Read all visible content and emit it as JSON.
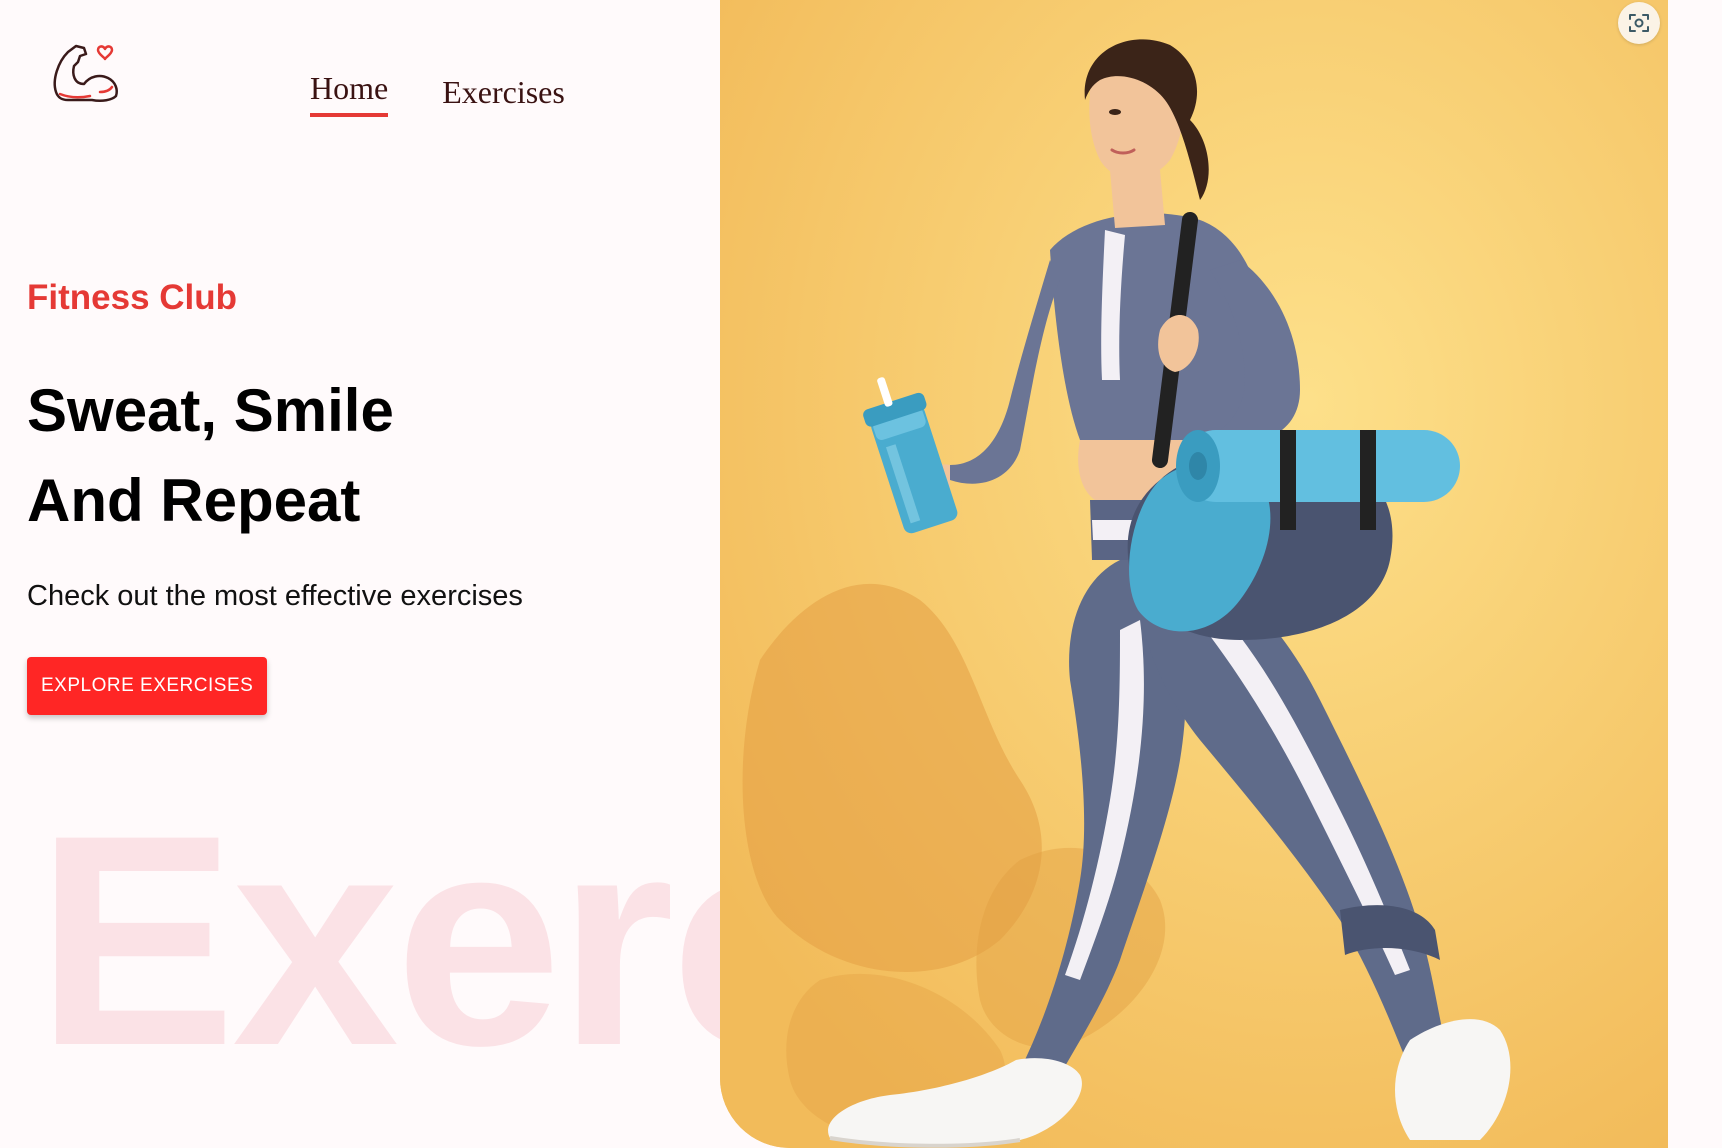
{
  "nav": {
    "logo_icon": "flexed-bicep-heart-icon",
    "items": [
      {
        "label": "Home",
        "active": true
      },
      {
        "label": "Exercises",
        "active": false
      }
    ]
  },
  "hero": {
    "subtitle": "Fitness Club",
    "headline_line1": "Sweat, Smile",
    "headline_line2": "And Repeat",
    "tagline": "Check out the most effective exercises",
    "cta_label": "Explore Exercises",
    "watermark": "Exercise",
    "image_alt": "Woman walking with shaker bottle and gym bag with yoga mat"
  },
  "toolbar": {
    "screenshot_icon": "screenshot-capture-icon"
  },
  "colors": {
    "accent": "#ff2625",
    "subtitle": "#e53935",
    "watermark": "#fbe2e6",
    "background": "#fffafb",
    "hero_bg": "#f6cd6e"
  }
}
